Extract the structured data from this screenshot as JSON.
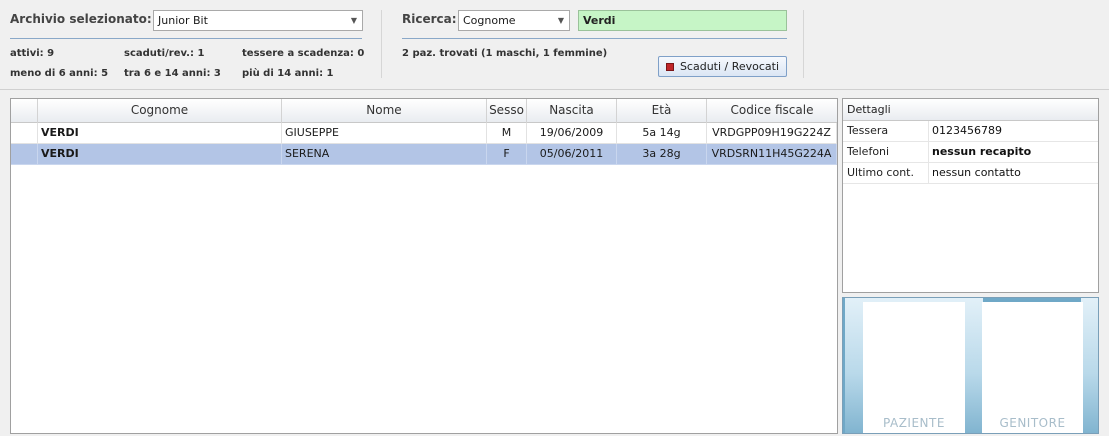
{
  "archive": {
    "label": "Archivio selezionato:",
    "selected": "Junior Bit"
  },
  "stats": {
    "attivi": "attivi: 9",
    "scaduti": "scaduti/rev.: 1",
    "tessere": "tessere a scadenza: 0",
    "meno6": "meno di 6 anni: 5",
    "tra6e14": "tra 6 e 14 anni: 3",
    "piu14": "più di 14 anni: 1"
  },
  "search": {
    "label": "Ricerca:",
    "field": "Cognome",
    "value": "Verdi",
    "result": "2 paz. trovati (1 maschi, 1 femmine)",
    "button": "Scaduti / Revocati"
  },
  "table": {
    "columns": [
      "Cognome",
      "Nome",
      "Sesso",
      "Nascita",
      "Età",
      "Codice fiscale"
    ],
    "rows": [
      {
        "cognome": "VERDI",
        "nome": "GIUSEPPE",
        "sesso": "M",
        "nascita": "19/06/2009",
        "eta": "5a 14g",
        "cf": "VRDGPP09H19G224Z",
        "selected": false
      },
      {
        "cognome": "VERDI",
        "nome": "SERENA",
        "sesso": "F",
        "nascita": "05/06/2011",
        "eta": "3a 28g",
        "cf": "VRDSRN11H45G224A",
        "selected": true
      }
    ]
  },
  "details": {
    "title": "Dettagli",
    "rows": [
      {
        "key": "Tessera",
        "value": "0123456789",
        "bold": false
      },
      {
        "key": "Telefoni",
        "value": "nessun recapito",
        "bold": true
      },
      {
        "key": "Ultimo cont.",
        "value": "nessun contatto",
        "bold": false
      }
    ]
  },
  "photos": {
    "paziente": "PAZIENTE",
    "genitore": "GENITORE"
  },
  "colors": {
    "selection": "#b3c5e6",
    "search_bg": "#c6f5c6",
    "revoke_icon": "#c0262b"
  }
}
